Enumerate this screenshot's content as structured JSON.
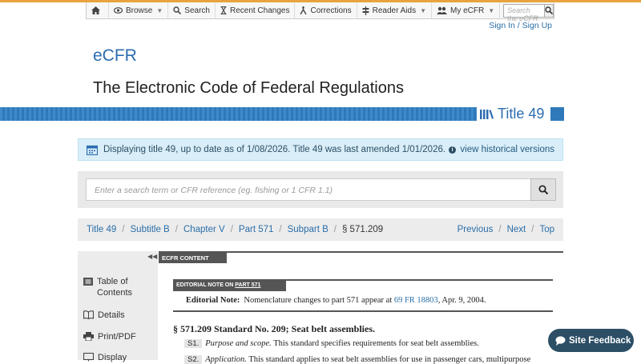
{
  "colors": {
    "accent": "#2b6cb0",
    "top_line": "#e8a33d",
    "stripe": "#2f79bb",
    "info_bg": "#d9eef8",
    "feedback_bg": "#2c4f66"
  },
  "nav": {
    "items": [
      {
        "label": "",
        "icon": "home-icon"
      },
      {
        "label": "Browse",
        "icon": "eye-icon",
        "caret": true
      },
      {
        "label": "Search",
        "icon": "search-icon"
      },
      {
        "label": "Recent Changes",
        "icon": "hourglass-icon"
      },
      {
        "label": "Corrections",
        "icon": "corrections-icon"
      },
      {
        "label": "Reader Aids",
        "icon": "signpost-icon",
        "caret": true
      },
      {
        "label": "My eCFR",
        "icon": "users-icon",
        "caret": true
      }
    ],
    "search_placeholder": "Search the eCFR"
  },
  "signin": "Sign In / Sign Up",
  "brand": "eCFR",
  "subtitle": "The Electronic Code of Federal Regulations",
  "title_label": "Title 49",
  "info": {
    "text": "Displaying title 49, up to date as of 1/08/2026. Title 49 was last amended 1/01/2026.",
    "link": "view historical versions"
  },
  "main_search": {
    "placeholder": "Enter a search term or CFR reference (eg. fishing or 1 CFR 1.1)"
  },
  "breadcrumb": {
    "items": [
      "Title 49",
      "Subtitle B",
      "Chapter V",
      "Part 571",
      "Subpart B"
    ],
    "current": "§ 571.209",
    "nav": [
      "Previous",
      "Next",
      "Top"
    ]
  },
  "sidebar": {
    "items": [
      {
        "label": "Table of Contents",
        "icon": "list-icon"
      },
      {
        "label": "Details",
        "icon": "book-icon"
      },
      {
        "label": "Print/PDF",
        "icon": "print-icon"
      },
      {
        "label": "Display",
        "icon": "display-icon"
      }
    ]
  },
  "content": {
    "tag": "ECFR CONTENT",
    "editorial_tag": "EDITORIAL NOTE ON",
    "editorial_tag_link": "PART 571",
    "editorial_label": "Editorial Note:",
    "editorial_text": "Nomenclature changes to part 571 appear at",
    "editorial_link": "69 FR 18803",
    "editorial_tail": ", Apr. 9, 2004.",
    "section_heading": "§ 571.209 Standard No. 209; Seat belt assemblies.",
    "paragraphs": [
      {
        "label": "S1.",
        "title": "Purpose and scope.",
        "text": "This standard specifies requirements for seat belt assemblies."
      },
      {
        "label": "S2.",
        "title": "Application.",
        "text": "This standard applies to seat belt assemblies for use in passenger cars, multipurpose"
      }
    ]
  },
  "feedback": {
    "label": "Site Feedback",
    "icon": "chat-icon"
  }
}
